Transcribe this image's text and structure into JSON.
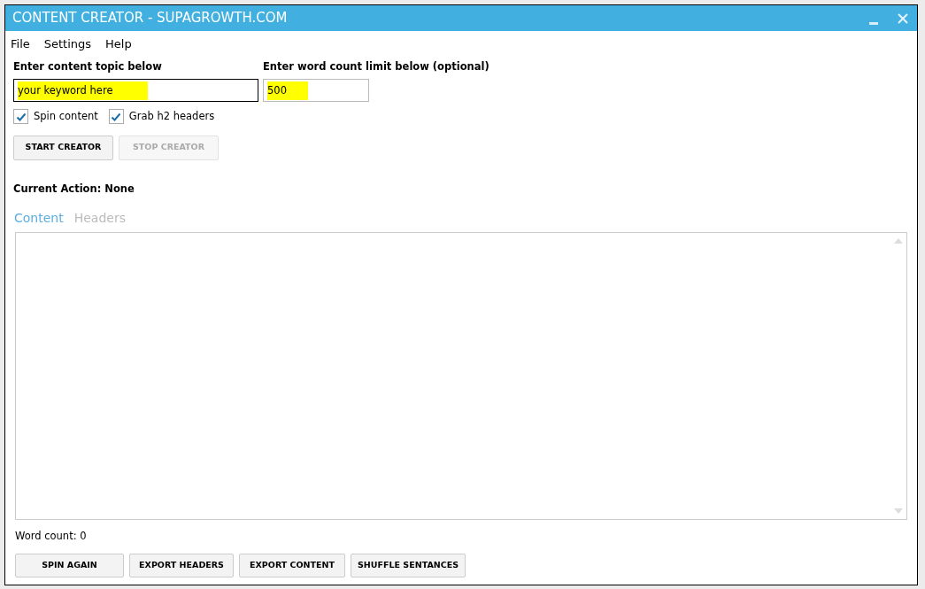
{
  "window": {
    "title": "CONTENT CREATOR - SUPAGROWTH.COM"
  },
  "menu": [
    "File",
    "Settings",
    "Help"
  ],
  "topic": {
    "label": "Enter content topic below",
    "value": "your keyword here"
  },
  "word_limit": {
    "label": "Enter word count limit below (optional)",
    "value": "500"
  },
  "options": [
    {
      "label": "Spin content",
      "checked": true
    },
    {
      "label": "Grab h2 headers",
      "checked": true
    }
  ],
  "actions": [
    {
      "label": "START CREATOR",
      "disabled": false
    },
    {
      "label": "STOP CREATOR",
      "disabled": true
    }
  ],
  "current_action": "Current Action: None",
  "tabs": [
    {
      "label": "Content",
      "selected": true
    },
    {
      "label": "Headers",
      "selected": false
    }
  ],
  "word_count": "Word count: 0",
  "bottom_buttons": [
    "SPIN AGAIN",
    "EXPORT HEADERS",
    "EXPORT CONTENT",
    "SHUFFLE SENTANCES"
  ]
}
